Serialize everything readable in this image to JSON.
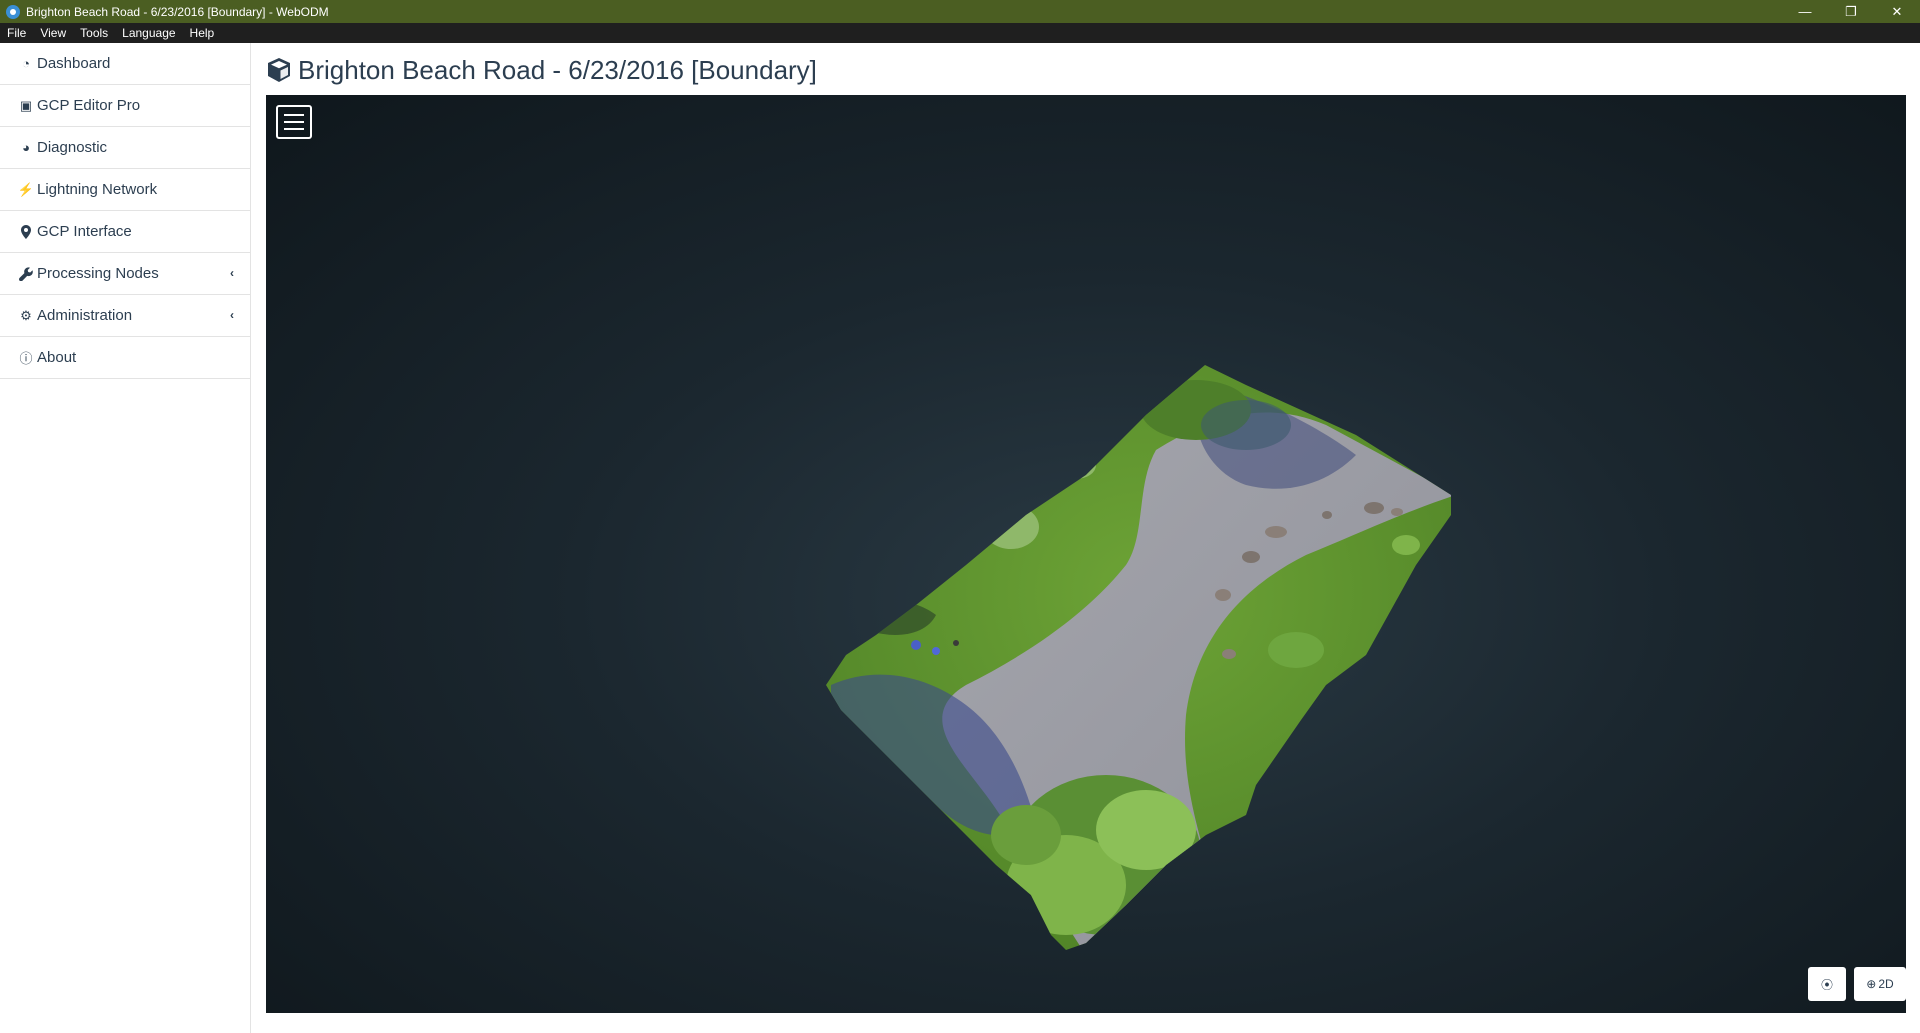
{
  "window": {
    "title": "Brighton Beach Road - 6/23/2016 [Boundary] - WebODM",
    "controls": {
      "minimize": "—",
      "restore": "❐",
      "close": "✕"
    }
  },
  "menubar": {
    "items": [
      "File",
      "View",
      "Tools",
      "Language",
      "Help"
    ]
  },
  "sidebar": {
    "items": [
      {
        "label": "Dashboard",
        "icon": "dashboard-icon",
        "glyph": "◔"
      },
      {
        "label": "GCP Editor Pro",
        "icon": "gcp-editor-icon",
        "glyph": "▣"
      },
      {
        "label": "Diagnostic",
        "icon": "pie-chart-icon",
        "glyph": "◕"
      },
      {
        "label": "Lightning Network",
        "icon": "bolt-icon",
        "glyph": "⚡"
      },
      {
        "label": "GCP Interface",
        "icon": "map-marker-icon",
        "glyph": "⬤"
      },
      {
        "label": "Processing Nodes",
        "icon": "wrench-icon",
        "glyph": "🔧",
        "chevron": "‹"
      },
      {
        "label": "Administration",
        "icon": "cogs-icon",
        "glyph": "⚙",
        "chevron": "‹"
      },
      {
        "label": "About",
        "icon": "info-icon",
        "glyph": "ⓘ"
      }
    ]
  },
  "main": {
    "title": "Brighton Beach Road - 6/23/2016 [Boundary]",
    "viewer": {
      "locate_glyph": "⦿",
      "toggle_label": "2D",
      "toggle_glyph": "⊕"
    }
  },
  "colors": {
    "titlebar": "#4b5e22",
    "menubar": "#1f1f1f",
    "text": "#2c3e50",
    "viewer_bg": "#1b272f",
    "grass": "#5f9a2e",
    "road": "#9e9ea6"
  }
}
